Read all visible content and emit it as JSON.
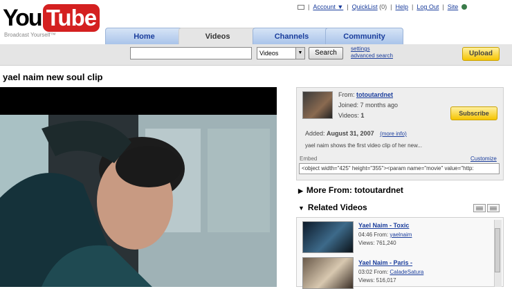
{
  "header": {
    "logo_you": "You",
    "logo_tube": "Tube",
    "tagline": "Broadcast Yourself™",
    "links": {
      "account": "Account ▼",
      "quicklist": "QuickList",
      "quicklist_count": "(0)",
      "help": "Help",
      "logout": "Log Out",
      "site": "Site"
    }
  },
  "tabs": [
    "Home",
    "Videos",
    "Channels",
    "Community"
  ],
  "search": {
    "query": "",
    "category": "Videos",
    "button": "Search",
    "settings": "settings",
    "advanced": "advanced search"
  },
  "upload_label": "Upload",
  "video": {
    "title": "yael naim new soul clip"
  },
  "channel": {
    "from_label": "From:",
    "from_user": "totoutardnet",
    "joined": "Joined: 7 months ago",
    "videos_label": "Videos:",
    "videos_count": "1",
    "subscribe": "Subscribe",
    "added_label": "Added:",
    "added_date": "August 31, 2007",
    "more_info": "(more info)",
    "description": "yael naim shows the first video clip of her new...",
    "embed_label": "Embed",
    "customize": "Customize",
    "embed_code": "<object width=\"425\" height=\"355\"><param name=\"movie\" value=\"http:"
  },
  "sections": {
    "more_from": "More From: totoutardnet",
    "related": "Related Videos"
  },
  "related": [
    {
      "title": "Yael Naim - Toxic",
      "duration": "04:46",
      "from_label": "From:",
      "from_user": "yaelnaim",
      "views": "Views: 761,240",
      "colors": [
        "#0d1a2a",
        "#3d6a8a"
      ]
    },
    {
      "title": "Yael Naim - Paris -",
      "duration": "03:02",
      "from_label": "From:",
      "from_user": "CaladeSatura",
      "views": "Views: 516,017",
      "colors": [
        "#6a5a4a",
        "#d8c8b0"
      ]
    }
  ]
}
